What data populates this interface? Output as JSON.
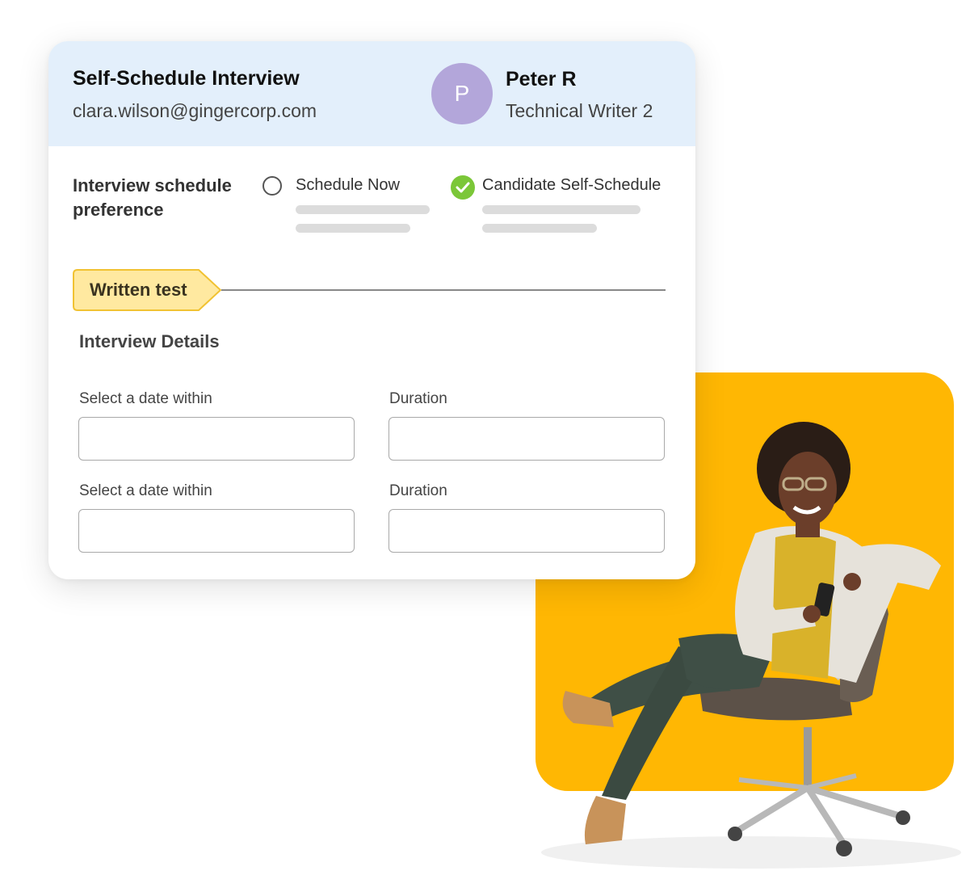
{
  "header": {
    "title": "Self-Schedule Interview",
    "email": "clara.wilson@gingercorp.com",
    "avatar_initial": "P",
    "candidate_name": "Peter R",
    "candidate_role": "Technical Writer 2"
  },
  "preference": {
    "label": "Interview schedule preference",
    "options": [
      {
        "label": "Schedule Now",
        "selected": false
      },
      {
        "label": "Candidate Self-Schedule",
        "selected": true
      }
    ]
  },
  "stage": {
    "tag": "Written test"
  },
  "details": {
    "title": "Interview Details",
    "rows": [
      {
        "date_label": "Select a date within",
        "duration_label": "Duration",
        "date_value": "",
        "duration_value": ""
      },
      {
        "date_label": "Select a date within",
        "duration_label": "Duration",
        "date_value": "",
        "duration_value": ""
      }
    ]
  },
  "colors": {
    "header_bg": "#E3EFFB",
    "avatar": "#B3A6DA",
    "check": "#7BC738",
    "tag": "#FFE9A0",
    "panel": "#FFB703"
  }
}
